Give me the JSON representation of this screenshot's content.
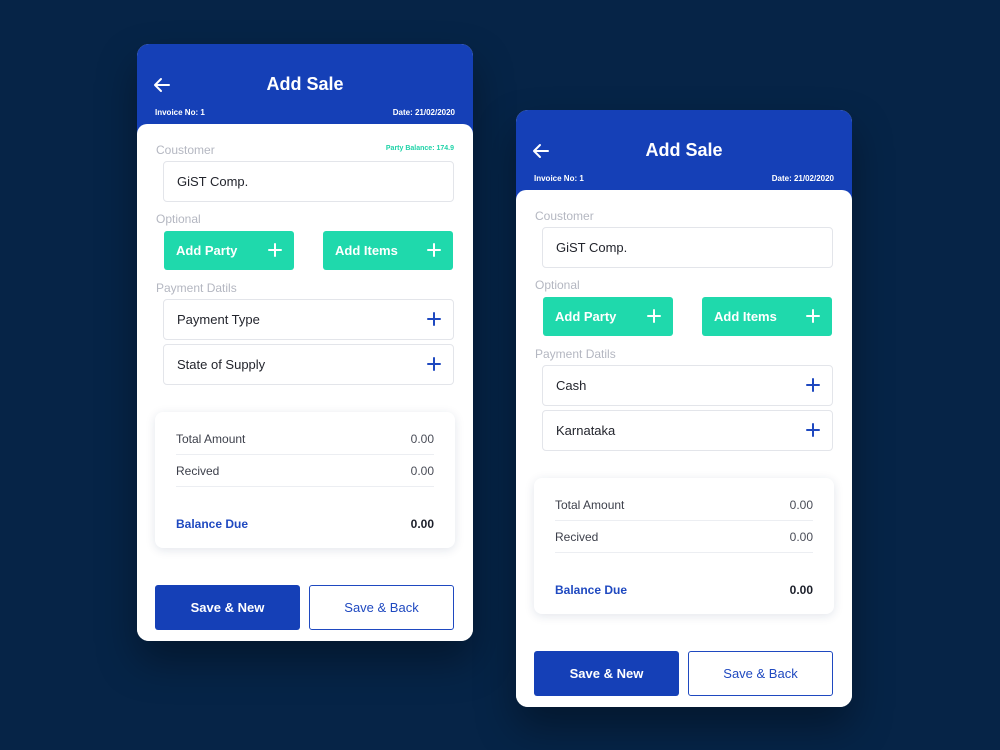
{
  "colors": {
    "background": "#062447",
    "header": "#1540b7",
    "accent_green": "#1fd9ac",
    "party_balance": "#1fd3a8",
    "balance_due": "#1f49c0"
  },
  "screens": [
    {
      "header": {
        "title": "Add Sale",
        "invoice_no": "Invoice No: 1",
        "date": "Date: 21/02/2020",
        "back_icon": "arrow-left-icon"
      },
      "customer": {
        "label": "Coustomer",
        "party_balance": "Party Balance: 174.9",
        "value": "GiST Comp."
      },
      "optional": {
        "label": "Optional",
        "add_party": "Add Party",
        "add_items": "Add Items"
      },
      "payment": {
        "label": "Payment Datils",
        "field1": "Payment Type",
        "field2": "State of Supply"
      },
      "summary": {
        "total_label": "Total Amount",
        "total_value": "0.00",
        "received_label": "Recived",
        "received_value": "0.00",
        "balance_label": "Balance Due",
        "balance_value": "0.00"
      },
      "actions": {
        "save_new": "Save & New",
        "save_back": "Save & Back"
      }
    },
    {
      "header": {
        "title": "Add Sale",
        "invoice_no": "Invoice No: 1",
        "date": "Date: 21/02/2020",
        "back_icon": "arrow-left-icon"
      },
      "customer": {
        "label": "Coustomer",
        "value": "GiST Comp."
      },
      "optional": {
        "label": "Optional",
        "add_party": "Add Party",
        "add_items": "Add Items"
      },
      "payment": {
        "label": "Payment Datils",
        "field1": "Cash",
        "field2": "Karnataka"
      },
      "summary": {
        "total_label": "Total Amount",
        "total_value": "0.00",
        "received_label": "Recived",
        "received_value": "0.00",
        "balance_label": "Balance Due",
        "balance_value": "0.00"
      },
      "actions": {
        "save_new": "Save & New",
        "save_back": "Save & Back"
      }
    }
  ]
}
